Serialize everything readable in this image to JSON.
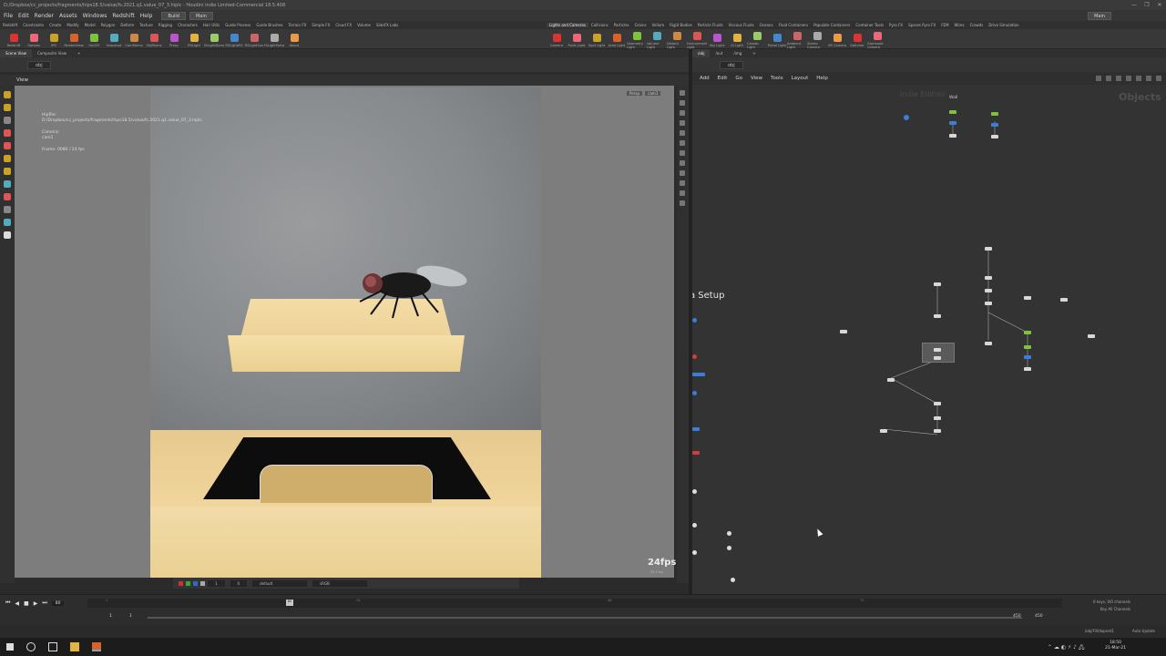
{
  "window": {
    "title": "D:/Dropbox/cc_projects/fragments/hips18.5/value/fs.2021.q1.value_07_3.hiplc - Houdini Indie Limited-Commercial 18.5.408",
    "controls": [
      "—",
      "❐",
      "✕"
    ]
  },
  "menu": {
    "items": [
      "File",
      "Edit",
      "Render",
      "Assets",
      "Windows",
      "Redshift",
      "Help"
    ],
    "desktop_left": "Build",
    "desktop_right": "Main",
    "desktop_far": "Main"
  },
  "shelf_tabs_left": [
    "Redshift",
    "Constraints",
    "Create",
    "Modify",
    "Model",
    "Polygon",
    "Deform",
    "Texture",
    "Rigging",
    "Characters",
    "Hair Utils",
    "Guide Process",
    "Guide Brushes",
    "Terrain FX",
    "Simple FX",
    "Cloud FX",
    "Volume",
    "SideFX Labs"
  ],
  "shelf_tabs_right": [
    "Lights and Cameras",
    "Collisions",
    "Particles",
    "Grains",
    "Vellum",
    "Rigid Bodies",
    "Particle Fluids",
    "Viscous Fluids",
    "Oceans",
    "Fluid Containers",
    "Populate Containers",
    "Container Tools",
    "Pyro FX",
    "Sparse Pyro FX",
    "FEM",
    "Wires",
    "Crowds",
    "Drive Simulation"
  ],
  "shelf_tools_left": [
    "Redshift",
    "Options",
    "IPR",
    "RenderView",
    "On/Off",
    "Snapshot",
    "CamParms",
    "ObjParms",
    "Proxy",
    "RSLight",
    "RSLightDome",
    "RSLightIES",
    "RSLightSun",
    "RSLightPortal",
    "About"
  ],
  "shelf_tools_right": [
    "Camera",
    "Point Light",
    "Spot Light",
    "Area Light",
    "Geometry Light",
    "Volume Light",
    "Distant Light",
    "Environment Light",
    "Sky Light",
    "GI Light",
    "Caustic Light",
    "Portal Light",
    "Ambient Light",
    "Stereo Camera",
    "VR Camera",
    "Switcher",
    "Gamepad Camera"
  ],
  "pane_tabs_left": [
    "Scene View",
    "Composite View"
  ],
  "pane_tabs_right": [
    "/obj",
    "/out",
    "/img"
  ],
  "path_left": "obj",
  "path_right": "obj",
  "viewport": {
    "label": "View",
    "hipfile_label": "Hipfile:",
    "hipfile": "D:/Dropbox/cc_projects/fragments/hips18.5/value/fs.2021.q1.value_07_3.hiplc",
    "camera_label": "Camera:",
    "camera": "cam1",
    "frame": "Frame: 0080 / 24 fps",
    "persp": "Persp",
    "cam": "cam1",
    "fps": "24fps",
    "fps_sub": "33.3 ms",
    "bottom_val1": "1",
    "bottom_val2": "0",
    "bottom_display": "default",
    "bottom_color": "sRGB"
  },
  "network": {
    "menu": [
      "Add",
      "Edit",
      "Go",
      "View",
      "Tools",
      "Layout",
      "Help"
    ],
    "watermark": "Indie Edition",
    "context_label": "Objects",
    "wall_label": "Wall",
    "netbox_label": "a Setup"
  },
  "timeline": {
    "frame": "80",
    "playhead": "80",
    "ticks": [
      "1",
      "",
      "",
      "",
      "",
      ""
    ],
    "tick_labels": [
      "24",
      "48",
      "72",
      "96",
      "120"
    ],
    "start": "1",
    "start2": "1",
    "end": "450",
    "end2": "450",
    "keys": "0 keys, 0/0 channels",
    "key_all": "Key All Channels"
  },
  "status": {
    "path": "/obj/Fill/dopnet1",
    "auto_update": "Auto Update"
  },
  "taskbar": {
    "time": "18:50",
    "date": "21-Mar-21"
  },
  "colors": {
    "node_green": "#7ec43a",
    "node_blue": "#3a7fd5",
    "node_red": "#d43d3d",
    "accent_orange": "#d9622a"
  }
}
